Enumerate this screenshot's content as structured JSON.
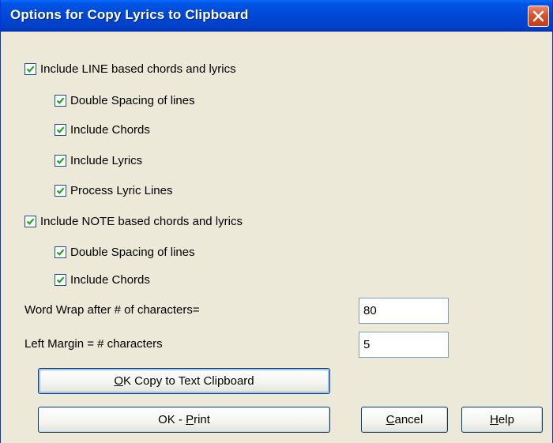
{
  "window": {
    "title": "Options for Copy Lyrics to Clipboard"
  },
  "options": {
    "line_based": {
      "label": "Include LINE based chords and lyrics",
      "checked": true
    },
    "line_double_spacing": {
      "label": "Double Spacing of lines",
      "checked": true
    },
    "line_include_chords": {
      "label": "Include Chords",
      "checked": true
    },
    "line_include_lyrics": {
      "label": "Include Lyrics",
      "checked": true
    },
    "line_process_lyric_lines": {
      "label": "Process Lyric Lines",
      "checked": true
    },
    "note_based": {
      "label": "Include NOTE based chords and lyrics",
      "checked": true
    },
    "note_double_spacing": {
      "label": "Double Spacing of lines",
      "checked": true
    },
    "note_include_chords": {
      "label": "Include Chords",
      "checked": true
    }
  },
  "fields": {
    "word_wrap": {
      "label": "Word Wrap after # of characters=",
      "value": "80"
    },
    "left_margin": {
      "label": "Left Margin = # characters",
      "value": "5"
    }
  },
  "buttons": {
    "ok_copy": {
      "label": "OK Copy to Text Clipboard",
      "mnemonic": "O"
    },
    "ok_print": {
      "label": "OK - Print",
      "mnemonic": "P"
    },
    "cancel": {
      "label": "Cancel",
      "mnemonic": "C"
    },
    "help": {
      "label": "Help",
      "mnemonic": "H"
    }
  },
  "colors": {
    "titlebar": "#0054e3",
    "dialog_bg": "#ece9d8",
    "checkmark": "#21a121",
    "close_button": "#d7522f"
  }
}
